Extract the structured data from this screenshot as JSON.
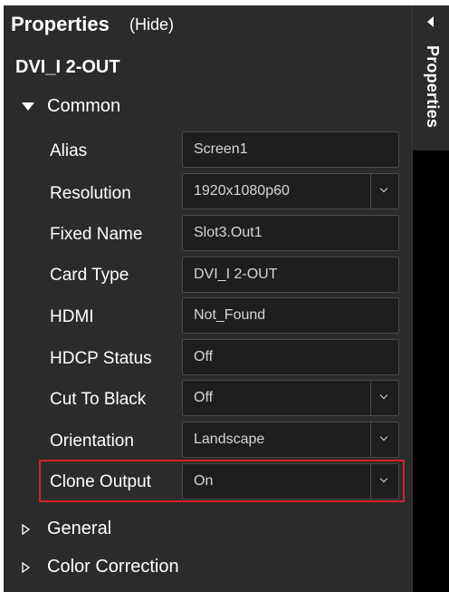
{
  "header": {
    "title": "Properties",
    "hide_label": "(Hide)"
  },
  "side_tab": {
    "label": "Properties"
  },
  "device": {
    "name": "DVI_I 2-OUT"
  },
  "sections": {
    "common": "Common",
    "general": "General",
    "color_correction": "Color Correction"
  },
  "properties": [
    {
      "label": "Alias",
      "value": "Screen1",
      "type": "text"
    },
    {
      "label": "Resolution",
      "value": "1920x1080p60",
      "type": "dropdown"
    },
    {
      "label": "Fixed Name",
      "value": "Slot3.Out1",
      "type": "readonly"
    },
    {
      "label": "Card Type",
      "value": "DVI_I 2-OUT",
      "type": "readonly"
    },
    {
      "label": "HDMI",
      "value": "Not_Found",
      "type": "readonly"
    },
    {
      "label": "HDCP Status",
      "value": "Off",
      "type": "readonly"
    },
    {
      "label": "Cut To Black",
      "value": "Off",
      "type": "dropdown"
    },
    {
      "label": "Orientation",
      "value": "Landscape",
      "type": "dropdown"
    },
    {
      "label": "Clone Output",
      "value": "On",
      "type": "dropdown"
    }
  ],
  "colors": {
    "panel_bg": "#2b2b2b",
    "field_bg": "#1e1e1e",
    "highlight": "#d0202a",
    "text": "#ffffff"
  }
}
